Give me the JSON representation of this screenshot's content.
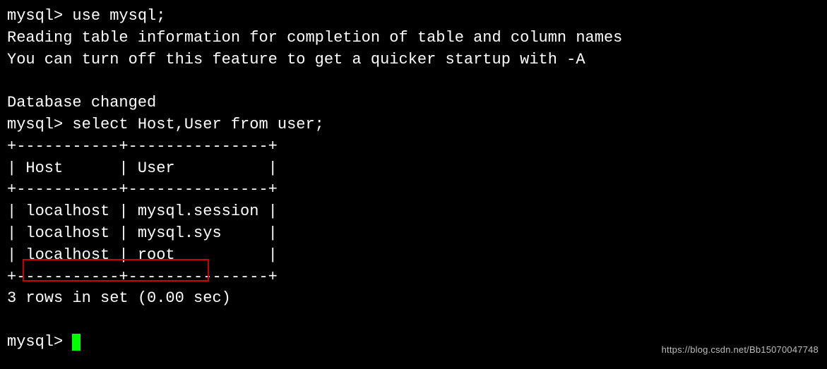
{
  "prompt": "mysql> ",
  "commands": {
    "use_db": "use mysql;",
    "select_query": "select Host,User from user;"
  },
  "messages": {
    "reading_info": "Reading table information for completion of table and column names",
    "turn_off": "You can turn off this feature to get a quicker startup with -A",
    "db_changed": "Database changed",
    "rows_in_set": "3 rows in set (0.00 sec)"
  },
  "table": {
    "border_top": "+-----------+---------------+",
    "border_mid": "+-----------+---------------+",
    "border_bottom": "+-----------+---------------+",
    "header": "| Host      | User          |",
    "rows": [
      "| localhost | mysql.session |",
      "| localhost | mysql.sys     |",
      "| localhost | root          |"
    ]
  },
  "watermark": "https://blog.csdn.net/Bb15070047748",
  "chart_data": {
    "type": "table",
    "columns": [
      "Host",
      "User"
    ],
    "rows": [
      [
        "localhost",
        "mysql.session"
      ],
      [
        "localhost",
        "mysql.sys"
      ],
      [
        "localhost",
        "root"
      ]
    ],
    "row_count": 3,
    "query_time_sec": 0.0
  }
}
